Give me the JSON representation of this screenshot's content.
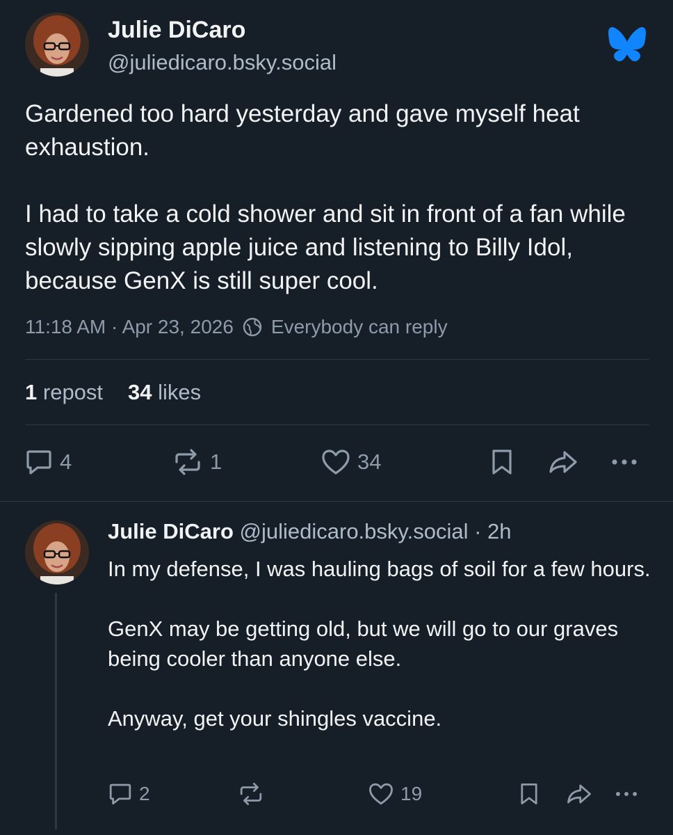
{
  "post": {
    "author_name": "Julie DiCaro",
    "author_handle": "@juliedicaro.bsky.social",
    "text": "Gardened too hard yesterday and gave myself heat exhaustion.\n\nI had to take a cold shower and sit in front of a fan while slowly sipping apple juice and listening to Billy Idol, because GenX is still super cool.",
    "timestamp": "11:18 AM · Apr 23, 2026",
    "reply_setting": "Everybody can reply",
    "repost_count": "1",
    "repost_label": "repost",
    "like_count": "34",
    "like_label": "likes",
    "actions": {
      "reply_count": "4",
      "repost_count": "1",
      "like_count": "34"
    }
  },
  "reply": {
    "author_name": "Julie DiCaro",
    "author_handle": "@juliedicaro.bsky.social",
    "time": "· 2h",
    "text": "In my defense, I was hauling bags of soil for a few hours.\n\nGenX may be getting old, but we will go to our graves being cooler than anyone else.\n\nAnyway, get your shingles vaccine.",
    "actions": {
      "reply_count": "2",
      "like_count": "19"
    }
  },
  "icons": {
    "brand": "bluesky-butterfly-icon",
    "brand_color": "#1185fe"
  }
}
